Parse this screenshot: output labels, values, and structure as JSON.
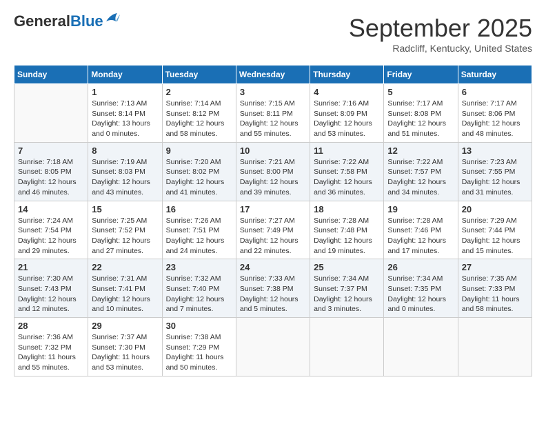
{
  "header": {
    "logo_general": "General",
    "logo_blue": "Blue",
    "month": "September 2025",
    "location": "Radcliff, Kentucky, United States"
  },
  "days_of_week": [
    "Sunday",
    "Monday",
    "Tuesday",
    "Wednesday",
    "Thursday",
    "Friday",
    "Saturday"
  ],
  "weeks": [
    [
      {
        "day": "",
        "sunrise": "",
        "sunset": "",
        "daylight": ""
      },
      {
        "day": "1",
        "sunrise": "Sunrise: 7:13 AM",
        "sunset": "Sunset: 8:14 PM",
        "daylight": "Daylight: 13 hours and 0 minutes."
      },
      {
        "day": "2",
        "sunrise": "Sunrise: 7:14 AM",
        "sunset": "Sunset: 8:12 PM",
        "daylight": "Daylight: 12 hours and 58 minutes."
      },
      {
        "day": "3",
        "sunrise": "Sunrise: 7:15 AM",
        "sunset": "Sunset: 8:11 PM",
        "daylight": "Daylight: 12 hours and 55 minutes."
      },
      {
        "day": "4",
        "sunrise": "Sunrise: 7:16 AM",
        "sunset": "Sunset: 8:09 PM",
        "daylight": "Daylight: 12 hours and 53 minutes."
      },
      {
        "day": "5",
        "sunrise": "Sunrise: 7:17 AM",
        "sunset": "Sunset: 8:08 PM",
        "daylight": "Daylight: 12 hours and 51 minutes."
      },
      {
        "day": "6",
        "sunrise": "Sunrise: 7:17 AM",
        "sunset": "Sunset: 8:06 PM",
        "daylight": "Daylight: 12 hours and 48 minutes."
      }
    ],
    [
      {
        "day": "7",
        "sunrise": "Sunrise: 7:18 AM",
        "sunset": "Sunset: 8:05 PM",
        "daylight": "Daylight: 12 hours and 46 minutes."
      },
      {
        "day": "8",
        "sunrise": "Sunrise: 7:19 AM",
        "sunset": "Sunset: 8:03 PM",
        "daylight": "Daylight: 12 hours and 43 minutes."
      },
      {
        "day": "9",
        "sunrise": "Sunrise: 7:20 AM",
        "sunset": "Sunset: 8:02 PM",
        "daylight": "Daylight: 12 hours and 41 minutes."
      },
      {
        "day": "10",
        "sunrise": "Sunrise: 7:21 AM",
        "sunset": "Sunset: 8:00 PM",
        "daylight": "Daylight: 12 hours and 39 minutes."
      },
      {
        "day": "11",
        "sunrise": "Sunrise: 7:22 AM",
        "sunset": "Sunset: 7:58 PM",
        "daylight": "Daylight: 12 hours and 36 minutes."
      },
      {
        "day": "12",
        "sunrise": "Sunrise: 7:22 AM",
        "sunset": "Sunset: 7:57 PM",
        "daylight": "Daylight: 12 hours and 34 minutes."
      },
      {
        "day": "13",
        "sunrise": "Sunrise: 7:23 AM",
        "sunset": "Sunset: 7:55 PM",
        "daylight": "Daylight: 12 hours and 31 minutes."
      }
    ],
    [
      {
        "day": "14",
        "sunrise": "Sunrise: 7:24 AM",
        "sunset": "Sunset: 7:54 PM",
        "daylight": "Daylight: 12 hours and 29 minutes."
      },
      {
        "day": "15",
        "sunrise": "Sunrise: 7:25 AM",
        "sunset": "Sunset: 7:52 PM",
        "daylight": "Daylight: 12 hours and 27 minutes."
      },
      {
        "day": "16",
        "sunrise": "Sunrise: 7:26 AM",
        "sunset": "Sunset: 7:51 PM",
        "daylight": "Daylight: 12 hours and 24 minutes."
      },
      {
        "day": "17",
        "sunrise": "Sunrise: 7:27 AM",
        "sunset": "Sunset: 7:49 PM",
        "daylight": "Daylight: 12 hours and 22 minutes."
      },
      {
        "day": "18",
        "sunrise": "Sunrise: 7:28 AM",
        "sunset": "Sunset: 7:48 PM",
        "daylight": "Daylight: 12 hours and 19 minutes."
      },
      {
        "day": "19",
        "sunrise": "Sunrise: 7:28 AM",
        "sunset": "Sunset: 7:46 PM",
        "daylight": "Daylight: 12 hours and 17 minutes."
      },
      {
        "day": "20",
        "sunrise": "Sunrise: 7:29 AM",
        "sunset": "Sunset: 7:44 PM",
        "daylight": "Daylight: 12 hours and 15 minutes."
      }
    ],
    [
      {
        "day": "21",
        "sunrise": "Sunrise: 7:30 AM",
        "sunset": "Sunset: 7:43 PM",
        "daylight": "Daylight: 12 hours and 12 minutes."
      },
      {
        "day": "22",
        "sunrise": "Sunrise: 7:31 AM",
        "sunset": "Sunset: 7:41 PM",
        "daylight": "Daylight: 12 hours and 10 minutes."
      },
      {
        "day": "23",
        "sunrise": "Sunrise: 7:32 AM",
        "sunset": "Sunset: 7:40 PM",
        "daylight": "Daylight: 12 hours and 7 minutes."
      },
      {
        "day": "24",
        "sunrise": "Sunrise: 7:33 AM",
        "sunset": "Sunset: 7:38 PM",
        "daylight": "Daylight: 12 hours and 5 minutes."
      },
      {
        "day": "25",
        "sunrise": "Sunrise: 7:34 AM",
        "sunset": "Sunset: 7:37 PM",
        "daylight": "Daylight: 12 hours and 3 minutes."
      },
      {
        "day": "26",
        "sunrise": "Sunrise: 7:34 AM",
        "sunset": "Sunset: 7:35 PM",
        "daylight": "Daylight: 12 hours and 0 minutes."
      },
      {
        "day": "27",
        "sunrise": "Sunrise: 7:35 AM",
        "sunset": "Sunset: 7:33 PM",
        "daylight": "Daylight: 11 hours and 58 minutes."
      }
    ],
    [
      {
        "day": "28",
        "sunrise": "Sunrise: 7:36 AM",
        "sunset": "Sunset: 7:32 PM",
        "daylight": "Daylight: 11 hours and 55 minutes."
      },
      {
        "day": "29",
        "sunrise": "Sunrise: 7:37 AM",
        "sunset": "Sunset: 7:30 PM",
        "daylight": "Daylight: 11 hours and 53 minutes."
      },
      {
        "day": "30",
        "sunrise": "Sunrise: 7:38 AM",
        "sunset": "Sunset: 7:29 PM",
        "daylight": "Daylight: 11 hours and 50 minutes."
      },
      {
        "day": "",
        "sunrise": "",
        "sunset": "",
        "daylight": ""
      },
      {
        "day": "",
        "sunrise": "",
        "sunset": "",
        "daylight": ""
      },
      {
        "day": "",
        "sunrise": "",
        "sunset": "",
        "daylight": ""
      },
      {
        "day": "",
        "sunrise": "",
        "sunset": "",
        "daylight": ""
      }
    ]
  ]
}
